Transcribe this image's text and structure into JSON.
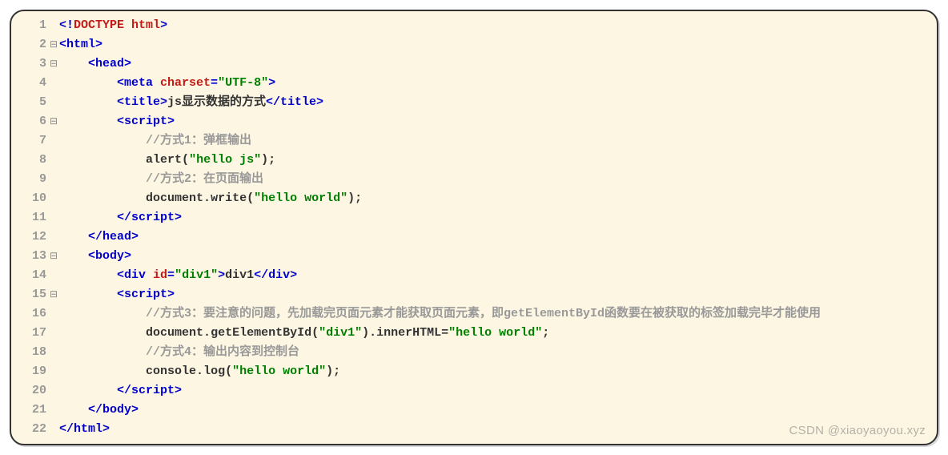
{
  "line_numbers": [
    "1",
    "2",
    "3",
    "4",
    "5",
    "6",
    "7",
    "8",
    "9",
    "10",
    "11",
    "12",
    "13",
    "14",
    "15",
    "16",
    "17",
    "18",
    "19",
    "20",
    "21",
    "22"
  ],
  "fold_markers": [
    "",
    "⊟",
    "⊟",
    "",
    "",
    "⊟",
    "",
    "",
    "",
    "",
    "",
    "",
    "⊟",
    "",
    "⊟",
    "",
    "",
    "",
    "",
    "",
    "",
    ""
  ],
  "code_lines": [
    [
      {
        "cls": "t-tag",
        "txt": "<!"
      },
      {
        "cls": "t-doctype",
        "txt": "DOCTYPE"
      },
      {
        "cls": "t-tag",
        "txt": " "
      },
      {
        "cls": "t-attr",
        "txt": "html"
      },
      {
        "cls": "t-tag",
        "txt": ">"
      }
    ],
    [
      {
        "cls": "t-tag",
        "txt": "<html>"
      }
    ],
    [
      {
        "cls": "t-text",
        "txt": "    "
      },
      {
        "cls": "t-tag",
        "txt": "<head>"
      }
    ],
    [
      {
        "cls": "t-text",
        "txt": "        "
      },
      {
        "cls": "t-tag",
        "txt": "<meta "
      },
      {
        "cls": "t-attr",
        "txt": "charset"
      },
      {
        "cls": "t-tag",
        "txt": "="
      },
      {
        "cls": "t-string",
        "txt": "\"UTF-8\""
      },
      {
        "cls": "t-tag",
        "txt": ">"
      }
    ],
    [
      {
        "cls": "t-text",
        "txt": "        "
      },
      {
        "cls": "t-tag",
        "txt": "<title>"
      },
      {
        "cls": "t-text",
        "txt": "js显示数据的方式"
      },
      {
        "cls": "t-tag",
        "txt": "</title>"
      }
    ],
    [
      {
        "cls": "t-text",
        "txt": "        "
      },
      {
        "cls": "t-tag",
        "txt": "<script>"
      }
    ],
    [
      {
        "cls": "t-text",
        "txt": "            "
      },
      {
        "cls": "t-comm",
        "txt": "//方式1：弹框输出"
      }
    ],
    [
      {
        "cls": "t-text",
        "txt": "            "
      },
      {
        "cls": "t-id",
        "txt": "alert"
      },
      {
        "cls": "t-punc",
        "txt": "("
      },
      {
        "cls": "t-string",
        "txt": "\"hello js\""
      },
      {
        "cls": "t-punc",
        "txt": ");"
      }
    ],
    [
      {
        "cls": "t-text",
        "txt": "            "
      },
      {
        "cls": "t-comm",
        "txt": "//方式2：在页面输出"
      }
    ],
    [
      {
        "cls": "t-text",
        "txt": "            "
      },
      {
        "cls": "t-id",
        "txt": "document"
      },
      {
        "cls": "t-dot",
        "txt": "."
      },
      {
        "cls": "t-id",
        "txt": "write"
      },
      {
        "cls": "t-punc",
        "txt": "("
      },
      {
        "cls": "t-string",
        "txt": "\"hello world\""
      },
      {
        "cls": "t-punc",
        "txt": ");"
      }
    ],
    [
      {
        "cls": "t-text",
        "txt": "        "
      },
      {
        "cls": "t-tag",
        "txt": "</script>"
      }
    ],
    [
      {
        "cls": "t-text",
        "txt": "    "
      },
      {
        "cls": "t-tag",
        "txt": "</head>"
      }
    ],
    [
      {
        "cls": "t-text",
        "txt": "    "
      },
      {
        "cls": "t-tag",
        "txt": "<body>"
      }
    ],
    [
      {
        "cls": "t-text",
        "txt": "        "
      },
      {
        "cls": "t-tag",
        "txt": "<div "
      },
      {
        "cls": "t-attr",
        "txt": "id"
      },
      {
        "cls": "t-tag",
        "txt": "="
      },
      {
        "cls": "t-string",
        "txt": "\"div1\""
      },
      {
        "cls": "t-tag",
        "txt": ">"
      },
      {
        "cls": "t-text",
        "txt": "div1"
      },
      {
        "cls": "t-tag",
        "txt": "</div>"
      }
    ],
    [
      {
        "cls": "t-text",
        "txt": "        "
      },
      {
        "cls": "t-tag",
        "txt": "<script>"
      }
    ],
    [
      {
        "cls": "t-text",
        "txt": "            "
      },
      {
        "cls": "t-comm",
        "txt": "//方式3：要注意的问题，先加载完页面元素才能获取页面元素，即getElementById函数要在被获取的标签加载完毕才能使用"
      }
    ],
    [
      {
        "cls": "t-text",
        "txt": "            "
      },
      {
        "cls": "t-id",
        "txt": "document"
      },
      {
        "cls": "t-dot",
        "txt": "."
      },
      {
        "cls": "t-id",
        "txt": "getElementById"
      },
      {
        "cls": "t-punc",
        "txt": "("
      },
      {
        "cls": "t-string",
        "txt": "\"div1\""
      },
      {
        "cls": "t-punc",
        "txt": ")."
      },
      {
        "cls": "t-id",
        "txt": "innerHTML"
      },
      {
        "cls": "t-punc",
        "txt": "="
      },
      {
        "cls": "t-string",
        "txt": "\"hello world\""
      },
      {
        "cls": "t-punc",
        "txt": ";"
      }
    ],
    [
      {
        "cls": "t-text",
        "txt": "            "
      },
      {
        "cls": "t-comm",
        "txt": "//方式4：输出内容到控制台"
      }
    ],
    [
      {
        "cls": "t-text",
        "txt": "            "
      },
      {
        "cls": "t-id",
        "txt": "console"
      },
      {
        "cls": "t-dot",
        "txt": "."
      },
      {
        "cls": "t-id",
        "txt": "log"
      },
      {
        "cls": "t-punc",
        "txt": "("
      },
      {
        "cls": "t-string",
        "txt": "\"hello world\""
      },
      {
        "cls": "t-punc",
        "txt": ");"
      }
    ],
    [
      {
        "cls": "t-text",
        "txt": "        "
      },
      {
        "cls": "t-tag",
        "txt": "</script>"
      }
    ],
    [
      {
        "cls": "t-text",
        "txt": "    "
      },
      {
        "cls": "t-tag",
        "txt": "</body>"
      }
    ],
    [
      {
        "cls": "t-tag",
        "txt": "</html>"
      }
    ]
  ],
  "watermark": "CSDN @xiaoyaoyou.xyz"
}
